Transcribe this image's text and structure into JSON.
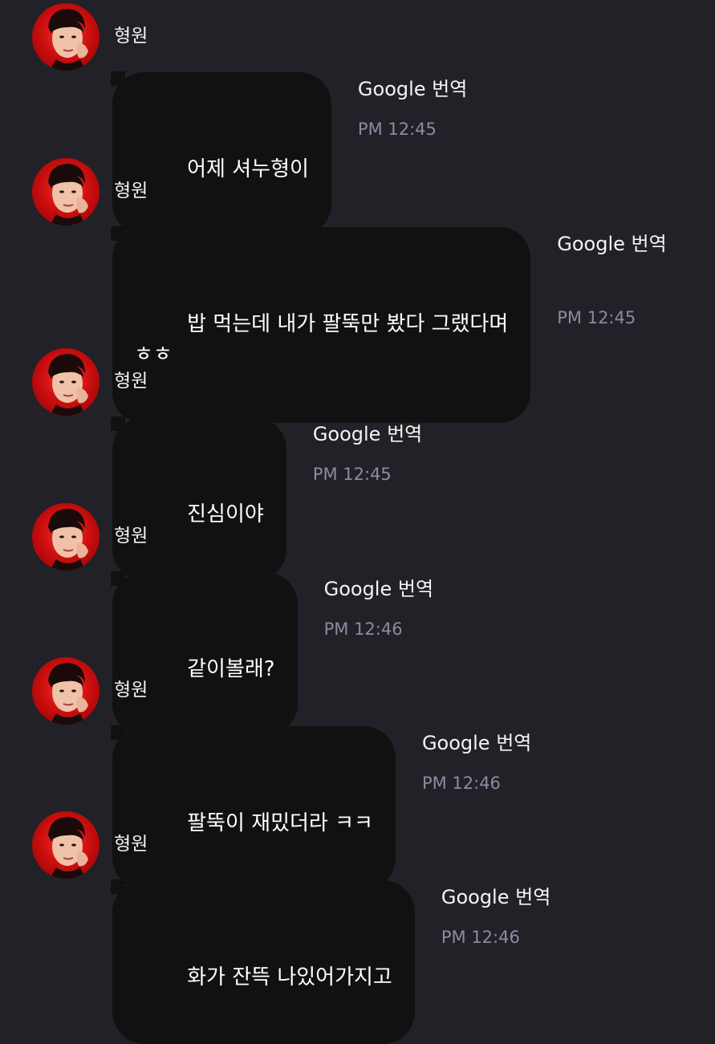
{
  "messages": [
    {
      "sender": "형원",
      "text": "어제 셔누형이",
      "translate": "Google 번역",
      "time": "PM 12:45"
    },
    {
      "sender": "형원",
      "text": "밥 먹는데 내가 팔뚝만 봤다 그랬다며\nㅎㅎ",
      "translate": "Google 번역",
      "time": "PM 12:45"
    },
    {
      "sender": "형원",
      "text": "진심이야",
      "translate": "Google 번역",
      "time": "PM 12:45"
    },
    {
      "sender": "형원",
      "text": "같이볼래?",
      "translate": "Google 번역",
      "time": "PM 12:46"
    },
    {
      "sender": "형원",
      "text": "팔뚝이 재밌더라 ㅋㅋ",
      "translate": "Google 번역",
      "time": "PM 12:46"
    },
    {
      "sender": "형원",
      "text": "화가 잔뜩 나있어가지고",
      "translate": "Google 번역",
      "time": "PM 12:46"
    }
  ],
  "colors": {
    "background": "#222128",
    "bubble": "#111111",
    "timestamp": "#8e8aa0",
    "avatar_accent": "#d01010"
  },
  "icons": {
    "avatar": "profile-photo"
  }
}
